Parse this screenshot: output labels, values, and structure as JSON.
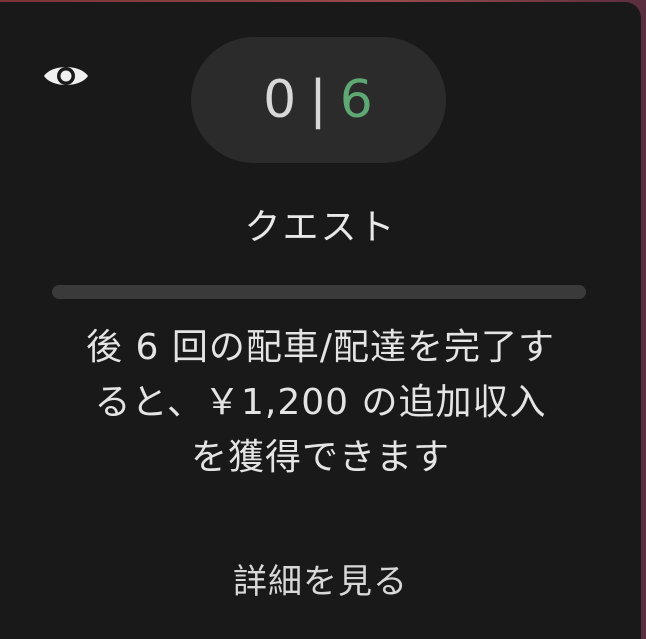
{
  "counter": {
    "current": "0",
    "separator": "|",
    "total": "6"
  },
  "quest": {
    "title": "クエスト",
    "progress_fraction": 0,
    "description_line1": "後 6 回の配車/配達を完了す",
    "description_line2": "ると、￥1,200 の追加収入",
    "description_line3": "を獲得できます",
    "details_label": "詳細を見る"
  },
  "icons": {
    "visibility": "eye-icon"
  },
  "colors": {
    "card_background": "#191919",
    "pill_background": "#2b2b2b",
    "accent_green": "#5ea873",
    "text_primary": "#e4e4e4",
    "progress_track": "#3a3a3a"
  }
}
